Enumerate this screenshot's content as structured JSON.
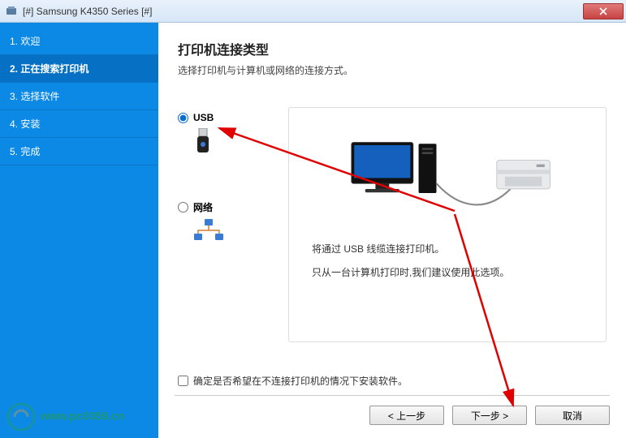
{
  "window": {
    "title": "[#] Samsung K4350 Series [#]"
  },
  "sidebar": {
    "items": [
      {
        "label": "1. 欢迎"
      },
      {
        "label": "2. 正在搜索打印机"
      },
      {
        "label": "3. 选择软件"
      },
      {
        "label": "4. 安装"
      },
      {
        "label": "5. 完成"
      }
    ],
    "active_index": 1
  },
  "main": {
    "heading": "打印机连接类型",
    "subheading": "选择打印机与计算机或网络的连接方式。",
    "options": {
      "usb": {
        "label": "USB",
        "checked": true
      },
      "network": {
        "label": "网络",
        "checked": false
      }
    },
    "panel": {
      "line1": "将通过 USB 线缆连接打印机。",
      "line2": "只从一台计算机打印时,我们建议使用此选项。"
    },
    "checkbox": {
      "label": "确定是否希望在不连接打印机的情况下安装软件。",
      "checked": false
    }
  },
  "buttons": {
    "back": "< 上一步",
    "next": "下一步 >",
    "cancel": "取消"
  },
  "watermark": {
    "url": "www.pc0359.cn"
  }
}
